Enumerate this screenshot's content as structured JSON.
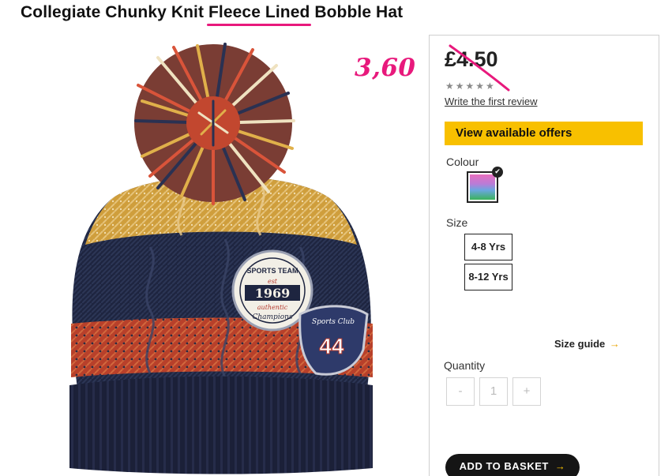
{
  "product": {
    "title_part1": "Collegiate Chunky Knit ",
    "title_highlight": "Fleece Lined",
    "title_part3": " Bobble Hat",
    "image_alt": "Collegiate Chunky Knit Fleece Lined Bobble Hat",
    "patch1": {
      "top_text": "SPORTS TEAM",
      "est": "est",
      "year": "1969",
      "script": "authentic",
      "bottom_text": "Champions"
    },
    "patch2": {
      "script": "Sports Club",
      "number": "44"
    }
  },
  "annotation": {
    "handwritten_price": "3,60",
    "color": "#e8197c"
  },
  "price": {
    "current": "£4.50",
    "stars": "★★★★★",
    "review_link": "Write the first review"
  },
  "offers": {
    "label": "View available offers",
    "color": "#f8c000"
  },
  "colour": {
    "label": "Colour",
    "check_icon": "✔"
  },
  "size": {
    "label": "Size",
    "options": [
      "4-8 Yrs",
      "8-12 Yrs"
    ],
    "guide_label": "Size guide",
    "guide_arrow": "→"
  },
  "quantity": {
    "label": "Quantity",
    "minus": "-",
    "value": "1",
    "plus": "+"
  },
  "basket": {
    "label": "ADD TO BASKET",
    "arrow": "→"
  }
}
